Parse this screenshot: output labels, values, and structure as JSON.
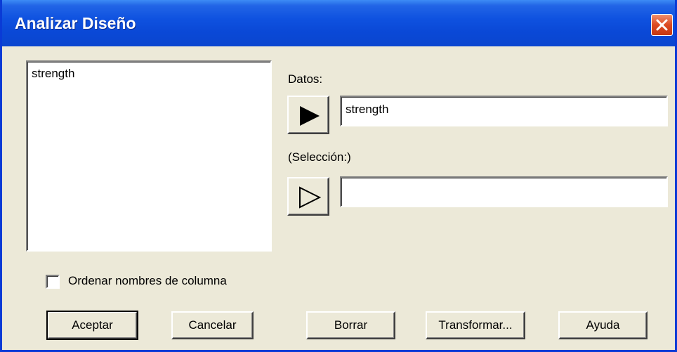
{
  "window": {
    "title": "Analizar Diseño"
  },
  "variables": {
    "items": [
      "strength"
    ]
  },
  "datos": {
    "label": "Datos:",
    "value": "strength"
  },
  "seleccion": {
    "label": "(Selección:)",
    "value": ""
  },
  "options": {
    "sort_label": "Ordenar nombres de columna",
    "sort_checked": false
  },
  "buttons": {
    "accept": "Aceptar",
    "cancel": "Cancelar",
    "clear": "Borrar",
    "transform": "Transformar...",
    "help": "Ayuda"
  },
  "icons": {
    "close": "close-icon",
    "datos_arrow": "filled-right-arrow-icon",
    "seleccion_arrow": "outline-right-arrow-icon"
  },
  "colors": {
    "titlebar": "#0a48d6",
    "close_button": "#dc4a22",
    "dialog_face": "#ece9d8"
  }
}
